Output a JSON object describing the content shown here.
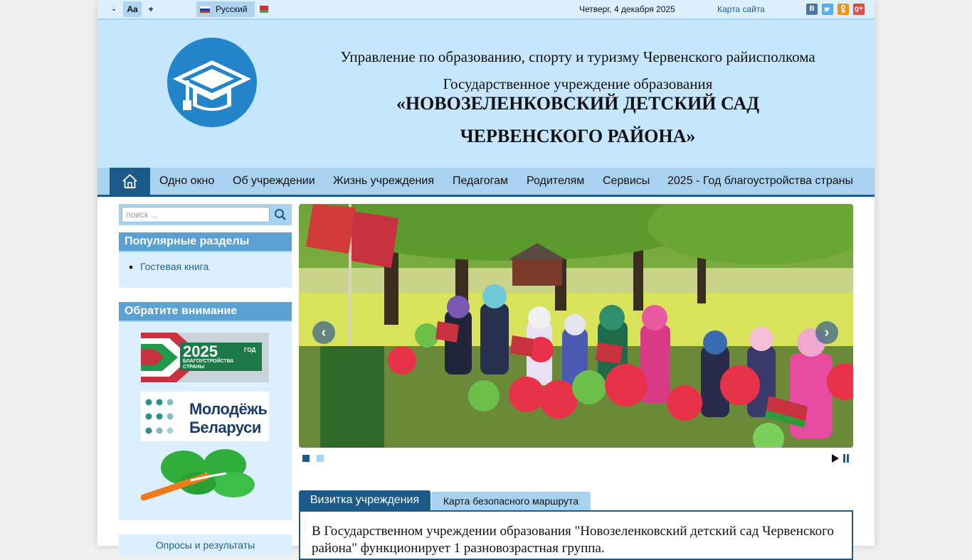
{
  "topbar": {
    "font_minus": "-",
    "font_normal": "Aa",
    "font_plus": "+",
    "language": "Русский",
    "date": "Четверг, 4 декабря 2025",
    "sitemap": "Карта сайта",
    "social_icons": [
      "vk-icon",
      "twitter-icon",
      "odnoklassniki-icon",
      "google-plus-icon"
    ]
  },
  "header": {
    "line1": "Управление по образованию, спорту и туризму Червенского райисполкома",
    "line2": "Государственное учреждение образования",
    "line3": "«НОВОЗЕЛЕНКОВСКИЙ ДЕТСКИЙ САД",
    "line4": "ЧЕРВЕНСКОГО РАЙОНА»"
  },
  "nav": {
    "home_icon": "home-icon",
    "items": [
      "Одно окно",
      "Об учреждении",
      "Жизнь учреждения",
      "Педагогам",
      "Родителям",
      "Сервисы",
      "2025 - Год благоустройства страны"
    ]
  },
  "sidebar": {
    "search_placeholder": "поиск ...",
    "popular": {
      "title": "Популярные разделы",
      "items": [
        "Гостевая книга"
      ]
    },
    "attention": {
      "title": "Обратите внимание",
      "banner1_year": "2025",
      "banner1_sub": "ГОД",
      "banner1_text1": "БЛАГОУСТРОЙСТВА",
      "banner1_text2": "СТРАНЫ",
      "banner2_line1": "Молодёжь",
      "banner2_line2": "Беларуси"
    },
    "polls_partial": "Опросы и результаты"
  },
  "slider": {
    "slide_count": 2,
    "active_slide": 1
  },
  "tabs": {
    "items": [
      "Визитка учреждения",
      "Карта безопасного маршрута"
    ],
    "active": 0,
    "content": "В Государственном учреждении образования \"Новозеленковский детский сад Червенского района\" функционирует 1 разновозрастная группа."
  },
  "colors": {
    "header_bg": "#c6e6fd",
    "nav_bg": "#a9d2f0",
    "accent_dark": "#1c5a8a",
    "module_title": "#5aa0d0",
    "logo_blue": "#2384c9"
  }
}
